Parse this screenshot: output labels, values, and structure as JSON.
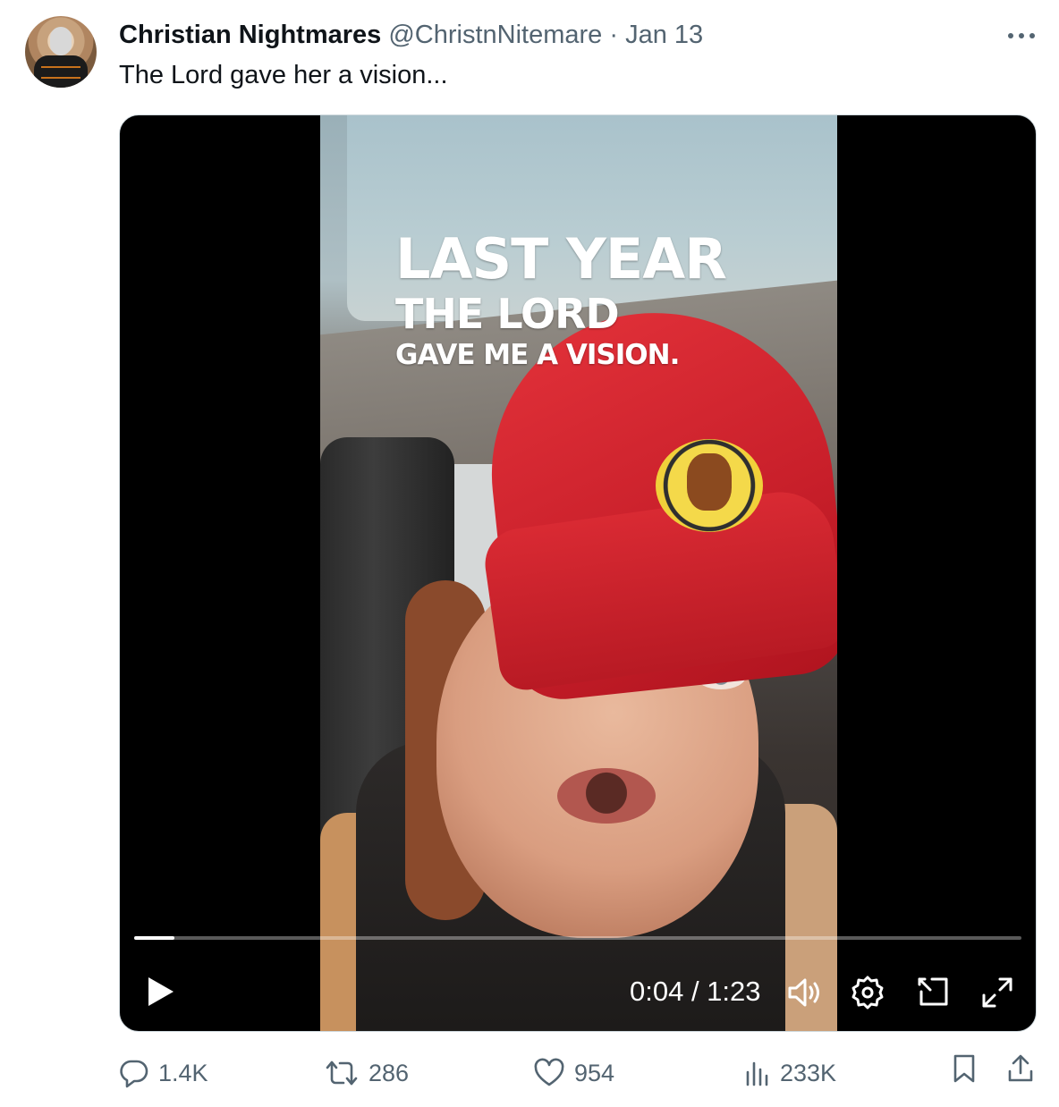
{
  "tweet": {
    "author_name": "Christian Nightmares",
    "handle": "@ChristnNitemare",
    "separator": "·",
    "date": "Jan 13",
    "more_label": "···",
    "text": "The Lord gave her a vision..."
  },
  "video": {
    "overlay_line1": "LAST YEAR",
    "overlay_line2": "THE LORD",
    "overlay_line3": "GAVE ME A VISION.",
    "time_display": "0:04 / 1:23",
    "current_time": "0:04",
    "duration": "1:23",
    "progress_fraction": 0.045
  },
  "actions": {
    "replies": "1.4K",
    "reposts": "286",
    "likes": "954",
    "views": "233K"
  },
  "colors": {
    "secondary_text": "#536471",
    "primary_text": "#0f1419",
    "video_bg": "#000000",
    "hat_red": "#d92a33"
  },
  "icons": [
    "more-icon",
    "play-icon",
    "volume-icon",
    "settings-icon",
    "dock-icon",
    "fullscreen-icon",
    "reply-icon",
    "repost-icon",
    "like-icon",
    "views-icon",
    "bookmark-icon",
    "share-icon"
  ]
}
